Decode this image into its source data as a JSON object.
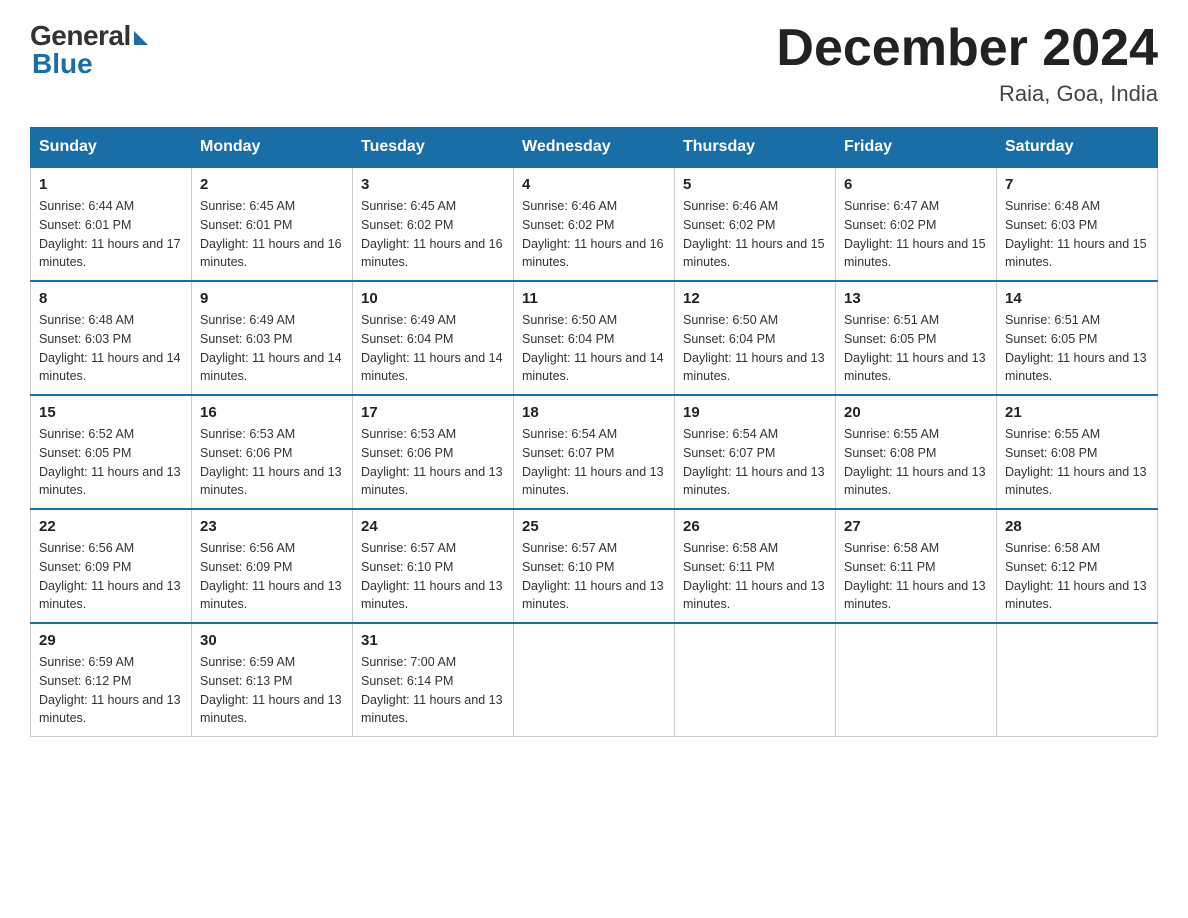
{
  "logo": {
    "general": "General",
    "blue": "Blue"
  },
  "header": {
    "month": "December 2024",
    "location": "Raia, Goa, India"
  },
  "weekdays": [
    "Sunday",
    "Monday",
    "Tuesday",
    "Wednesday",
    "Thursday",
    "Friday",
    "Saturday"
  ],
  "weeks": [
    [
      {
        "day": "1",
        "sunrise": "6:44 AM",
        "sunset": "6:01 PM",
        "daylight": "11 hours and 17 minutes."
      },
      {
        "day": "2",
        "sunrise": "6:45 AM",
        "sunset": "6:01 PM",
        "daylight": "11 hours and 16 minutes."
      },
      {
        "day": "3",
        "sunrise": "6:45 AM",
        "sunset": "6:02 PM",
        "daylight": "11 hours and 16 minutes."
      },
      {
        "day": "4",
        "sunrise": "6:46 AM",
        "sunset": "6:02 PM",
        "daylight": "11 hours and 16 minutes."
      },
      {
        "day": "5",
        "sunrise": "6:46 AM",
        "sunset": "6:02 PM",
        "daylight": "11 hours and 15 minutes."
      },
      {
        "day": "6",
        "sunrise": "6:47 AM",
        "sunset": "6:02 PM",
        "daylight": "11 hours and 15 minutes."
      },
      {
        "day": "7",
        "sunrise": "6:48 AM",
        "sunset": "6:03 PM",
        "daylight": "11 hours and 15 minutes."
      }
    ],
    [
      {
        "day": "8",
        "sunrise": "6:48 AM",
        "sunset": "6:03 PM",
        "daylight": "11 hours and 14 minutes."
      },
      {
        "day": "9",
        "sunrise": "6:49 AM",
        "sunset": "6:03 PM",
        "daylight": "11 hours and 14 minutes."
      },
      {
        "day": "10",
        "sunrise": "6:49 AM",
        "sunset": "6:04 PM",
        "daylight": "11 hours and 14 minutes."
      },
      {
        "day": "11",
        "sunrise": "6:50 AM",
        "sunset": "6:04 PM",
        "daylight": "11 hours and 14 minutes."
      },
      {
        "day": "12",
        "sunrise": "6:50 AM",
        "sunset": "6:04 PM",
        "daylight": "11 hours and 13 minutes."
      },
      {
        "day": "13",
        "sunrise": "6:51 AM",
        "sunset": "6:05 PM",
        "daylight": "11 hours and 13 minutes."
      },
      {
        "day": "14",
        "sunrise": "6:51 AM",
        "sunset": "6:05 PM",
        "daylight": "11 hours and 13 minutes."
      }
    ],
    [
      {
        "day": "15",
        "sunrise": "6:52 AM",
        "sunset": "6:05 PM",
        "daylight": "11 hours and 13 minutes."
      },
      {
        "day": "16",
        "sunrise": "6:53 AM",
        "sunset": "6:06 PM",
        "daylight": "11 hours and 13 minutes."
      },
      {
        "day": "17",
        "sunrise": "6:53 AM",
        "sunset": "6:06 PM",
        "daylight": "11 hours and 13 minutes."
      },
      {
        "day": "18",
        "sunrise": "6:54 AM",
        "sunset": "6:07 PM",
        "daylight": "11 hours and 13 minutes."
      },
      {
        "day": "19",
        "sunrise": "6:54 AM",
        "sunset": "6:07 PM",
        "daylight": "11 hours and 13 minutes."
      },
      {
        "day": "20",
        "sunrise": "6:55 AM",
        "sunset": "6:08 PM",
        "daylight": "11 hours and 13 minutes."
      },
      {
        "day": "21",
        "sunrise": "6:55 AM",
        "sunset": "6:08 PM",
        "daylight": "11 hours and 13 minutes."
      }
    ],
    [
      {
        "day": "22",
        "sunrise": "6:56 AM",
        "sunset": "6:09 PM",
        "daylight": "11 hours and 13 minutes."
      },
      {
        "day": "23",
        "sunrise": "6:56 AM",
        "sunset": "6:09 PM",
        "daylight": "11 hours and 13 minutes."
      },
      {
        "day": "24",
        "sunrise": "6:57 AM",
        "sunset": "6:10 PM",
        "daylight": "11 hours and 13 minutes."
      },
      {
        "day": "25",
        "sunrise": "6:57 AM",
        "sunset": "6:10 PM",
        "daylight": "11 hours and 13 minutes."
      },
      {
        "day": "26",
        "sunrise": "6:58 AM",
        "sunset": "6:11 PM",
        "daylight": "11 hours and 13 minutes."
      },
      {
        "day": "27",
        "sunrise": "6:58 AM",
        "sunset": "6:11 PM",
        "daylight": "11 hours and 13 minutes."
      },
      {
        "day": "28",
        "sunrise": "6:58 AM",
        "sunset": "6:12 PM",
        "daylight": "11 hours and 13 minutes."
      }
    ],
    [
      {
        "day": "29",
        "sunrise": "6:59 AM",
        "sunset": "6:12 PM",
        "daylight": "11 hours and 13 minutes."
      },
      {
        "day": "30",
        "sunrise": "6:59 AM",
        "sunset": "6:13 PM",
        "daylight": "11 hours and 13 minutes."
      },
      {
        "day": "31",
        "sunrise": "7:00 AM",
        "sunset": "6:14 PM",
        "daylight": "11 hours and 13 minutes."
      },
      null,
      null,
      null,
      null
    ]
  ]
}
